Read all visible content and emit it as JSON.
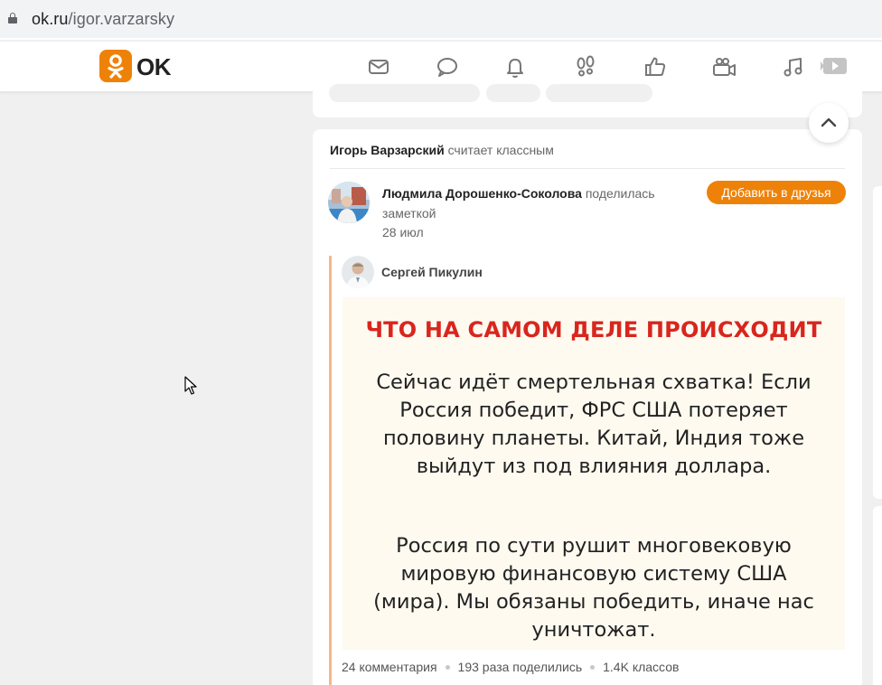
{
  "browser": {
    "url_domain": "ok.ru",
    "url_path": "/igor.varzarsky"
  },
  "header": {
    "logo_text": "OK",
    "nav_icons": [
      "mail-icon",
      "chat-icon",
      "bell-icon",
      "footprints-icon",
      "thumbs-up-icon",
      "video-camera-icon",
      "music-icon",
      "play-icon"
    ],
    "accent_color": "#ee8208"
  },
  "feed": {
    "activity": {
      "actor": "Игорь Варзарский",
      "action": "считает классным"
    },
    "post": {
      "author": "Людмила Дорошенко-Соколова",
      "action": "поделилась заметкой",
      "date": "28 июл",
      "add_friend_label": "Добавить в друзья",
      "repost_author": "Сергей Пикулин",
      "image": {
        "headline": "ЧТО НА САМОМ ДЕЛЕ ПРОИСХОДИТ",
        "paragraph1": "Сейчас идёт смертельная схватка! Если Россия победит, ФРС США потеряет половину планеты. Китай, Индия тоже выйдут из под влияния доллара.",
        "paragraph2": "Россия по сути рушит многовековую мировую финансовую систему США (мира). Мы обязаны победить, иначе нас уничтожат."
      },
      "stats": {
        "comments": "24 комментария",
        "shares": "193 раза поделились",
        "likes": "1.4K классов"
      }
    }
  }
}
